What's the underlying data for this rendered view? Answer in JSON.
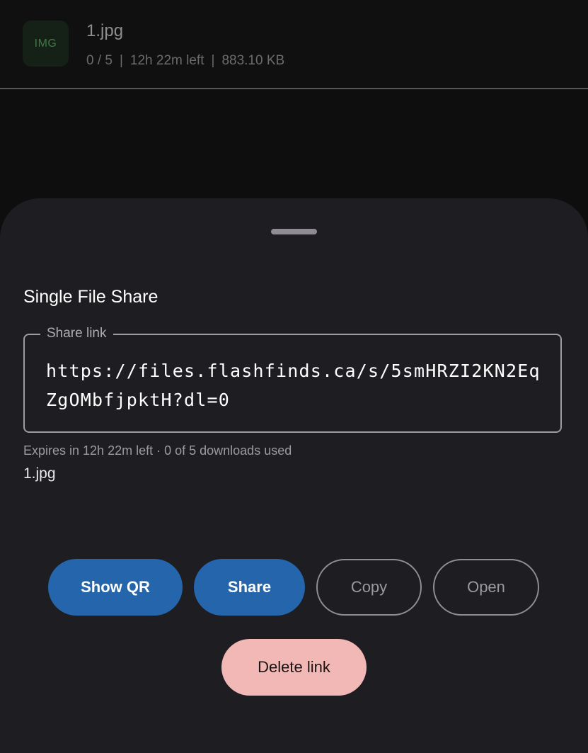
{
  "file_row": {
    "thumb_label": "IMG",
    "name": "1.jpg",
    "downloads": "0 / 5",
    "separator": "|",
    "time_left": "12h 22m left",
    "size": "883.10 KB"
  },
  "sheet": {
    "title": "Single File Share",
    "link_label": "Share link",
    "link_url": "https://files.flashfinds.ca/s/5smHRZI2KN2EqZgOMbfjpktH?dl=0",
    "expiry_text": "Expires in 12h 22m left · 0 of 5 downloads used",
    "file_name": "1.jpg",
    "buttons": {
      "show_qr": "Show QR",
      "share": "Share",
      "copy": "Copy",
      "open": "Open",
      "delete": "Delete link"
    }
  },
  "colors": {
    "primary_button": "#2465ab",
    "danger_button": "#f1b8b6",
    "sheet_background": "#1e1d21",
    "thumb_text": "#3d7a43"
  }
}
